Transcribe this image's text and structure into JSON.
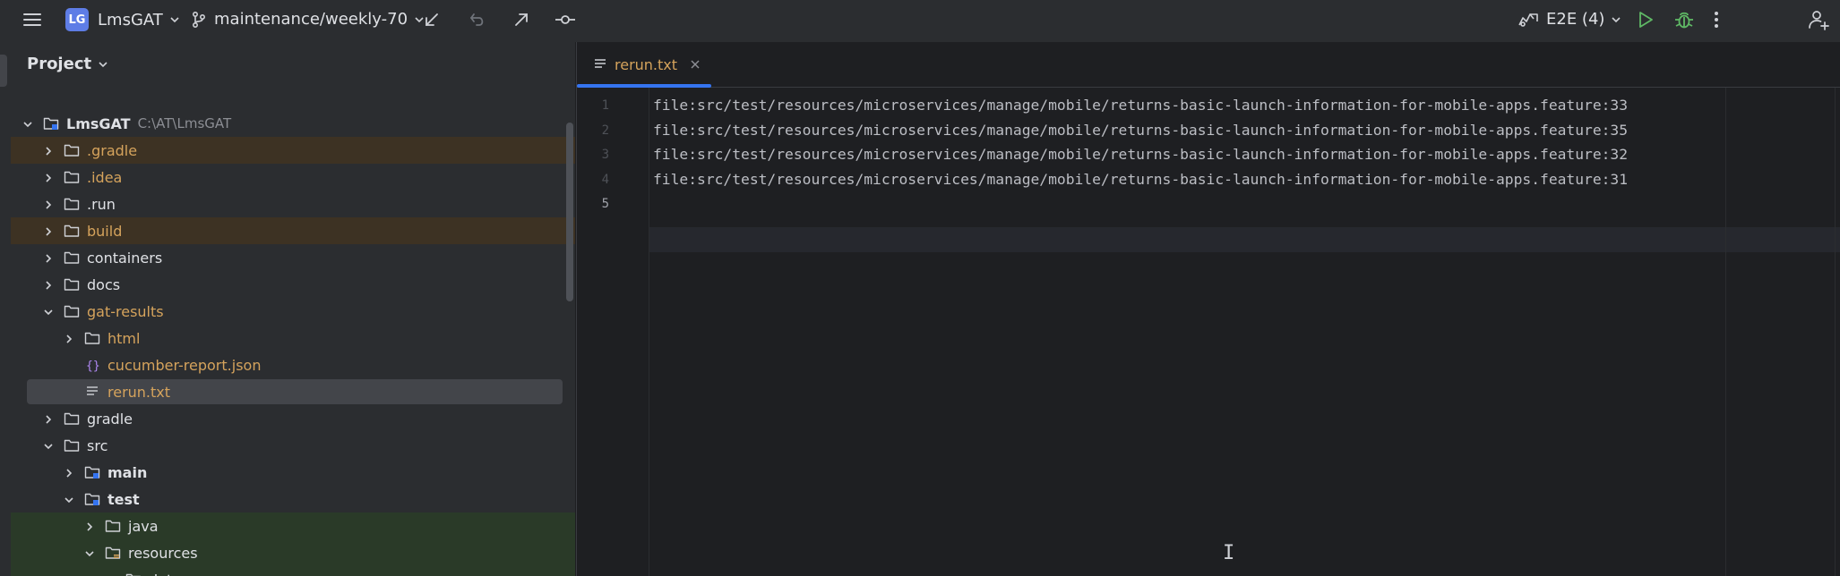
{
  "titlebar": {
    "project_badge": "LG",
    "project_name": "LmsGAT",
    "branch": "maintenance/weekly-70",
    "run_config": "E2E (4)"
  },
  "project_panel": {
    "title": "Project",
    "tree": [
      {
        "label": "LmsGAT",
        "path": "C:\\AT\\LmsGAT",
        "depth": 0,
        "expanded": true,
        "icon": "module-icon",
        "style": "bold"
      },
      {
        "label": ".gradle",
        "depth": 1,
        "expanded": false,
        "icon": "folder-icon",
        "style": "orange",
        "bg": "excluded"
      },
      {
        "label": ".idea",
        "depth": 1,
        "expanded": false,
        "icon": "folder-icon",
        "style": "orange"
      },
      {
        "label": ".run",
        "depth": 1,
        "expanded": false,
        "icon": "folder-icon"
      },
      {
        "label": "build",
        "depth": 1,
        "expanded": false,
        "icon": "folder-icon",
        "style": "orange",
        "bg": "excluded"
      },
      {
        "label": "containers",
        "depth": 1,
        "expanded": false,
        "icon": "folder-icon"
      },
      {
        "label": "docs",
        "depth": 1,
        "expanded": false,
        "icon": "folder-icon"
      },
      {
        "label": "gat-results",
        "depth": 1,
        "expanded": true,
        "icon": "folder-icon",
        "style": "orange"
      },
      {
        "label": "html",
        "depth": 2,
        "expanded": false,
        "icon": "folder-icon",
        "style": "orange"
      },
      {
        "label": "cucumber-report.json",
        "depth": 2,
        "leaf": true,
        "icon": "json-file-icon",
        "style": "orange"
      },
      {
        "label": "rerun.txt",
        "depth": 2,
        "leaf": true,
        "icon": "text-file-icon",
        "style": "orange",
        "selected": true
      },
      {
        "label": "gradle",
        "depth": 1,
        "expanded": false,
        "icon": "folder-icon"
      },
      {
        "label": "src",
        "depth": 1,
        "expanded": true,
        "icon": "folder-icon"
      },
      {
        "label": "main",
        "depth": 2,
        "expanded": false,
        "icon": "source-folder-icon",
        "style": "bold"
      },
      {
        "label": "test",
        "depth": 2,
        "expanded": true,
        "icon": "source-folder-icon",
        "style": "bold"
      },
      {
        "label": "java",
        "depth": 3,
        "expanded": false,
        "icon": "test-folder-icon",
        "bg": "test-root"
      },
      {
        "label": "resources",
        "depth": 3,
        "expanded": true,
        "icon": "resources-folder-icon",
        "bg": "test-root"
      },
      {
        "label": "data-source",
        "depth": 4,
        "expanded": false,
        "icon": "folder-icon",
        "bg": "test-root"
      }
    ]
  },
  "editor": {
    "tab_label": "rerun.txt",
    "lines": [
      {
        "no": "1",
        "text": "file:src/test/resources/microservices/manage/mobile/returns-basic-launch-information-for-mobile-apps.feature:33"
      },
      {
        "no": "2",
        "text": "file:src/test/resources/microservices/manage/mobile/returns-basic-launch-information-for-mobile-apps.feature:35"
      },
      {
        "no": "3",
        "text": "file:src/test/resources/microservices/manage/mobile/returns-basic-launch-information-for-mobile-apps.feature:32"
      },
      {
        "no": "4",
        "text": "file:src/test/resources/microservices/manage/mobile/returns-basic-launch-information-for-mobile-apps.feature:31"
      },
      {
        "no": "5",
        "text": ""
      }
    ],
    "current_line": 5
  },
  "colors": {
    "accent": "#3574f0",
    "orange_text": "#d5a35c",
    "run_green": "#5fb865",
    "excluded_bg": "#3d3223",
    "test_root_bg": "#2a3a28"
  }
}
